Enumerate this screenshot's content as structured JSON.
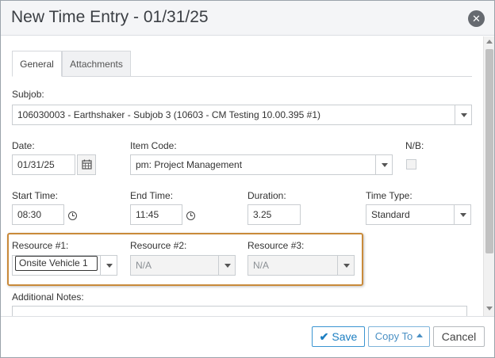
{
  "dialog": {
    "title": "New Time Entry - 01/31/25"
  },
  "tabs": [
    {
      "label": "General",
      "active": true
    },
    {
      "label": "Attachments",
      "active": false
    }
  ],
  "form": {
    "subjob": {
      "label": "Subjob:",
      "value": "106030003 - Earthshaker - Subjob 3 (10603 - CM Testing 10.00.395 #1)"
    },
    "date": {
      "label": "Date:",
      "value": "01/31/25"
    },
    "item_code": {
      "label": "Item Code:",
      "value": "pm: Project Management"
    },
    "nb": {
      "label": "N/B:",
      "checked": false
    },
    "start_time": {
      "label": "Start Time:",
      "value": "08:30"
    },
    "end_time": {
      "label": "End Time:",
      "value": "11:45"
    },
    "duration": {
      "label": "Duration:",
      "value": "3.25"
    },
    "time_type": {
      "label": "Time Type:",
      "value": "Standard"
    },
    "resource1": {
      "label": "Resource #1:",
      "value": "Onsite Vehicle 1"
    },
    "resource2": {
      "label": "Resource #2:",
      "value": "N/A"
    },
    "resource3": {
      "label": "Resource #3:",
      "value": "N/A"
    },
    "additional_notes": {
      "label": "Additional Notes:",
      "value": ""
    }
  },
  "footer": {
    "save_label": "Save",
    "copy_label": "Copy To",
    "cancel_label": "Cancel"
  },
  "colors": {
    "highlight_border": "#c98a3a",
    "primary": "#1d7fc2"
  },
  "icons": [
    "close-icon",
    "calendar-icon",
    "clock-icon",
    "chevron-down-icon",
    "check-icon",
    "caret-up-icon"
  ]
}
